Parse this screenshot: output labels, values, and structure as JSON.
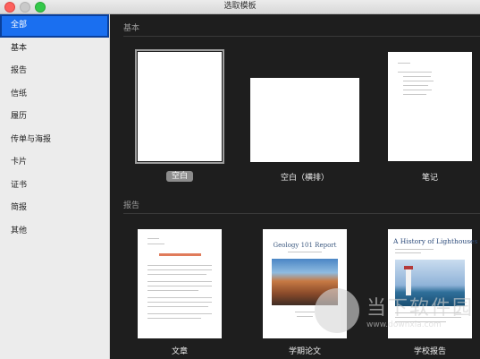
{
  "window": {
    "title": "选取模板"
  },
  "sidebar": {
    "items": [
      {
        "label": "全部",
        "active": true
      },
      {
        "label": "基本",
        "active": false
      },
      {
        "label": "报告",
        "active": false
      },
      {
        "label": "信纸",
        "active": false
      },
      {
        "label": "履历",
        "active": false
      },
      {
        "label": "传单与海报",
        "active": false
      },
      {
        "label": "卡片",
        "active": false
      },
      {
        "label": "证书",
        "active": false
      },
      {
        "label": "简报",
        "active": false
      },
      {
        "label": "其他",
        "active": false
      }
    ]
  },
  "sections": [
    {
      "title": "基本",
      "templates": [
        {
          "label": "空白",
          "selected": true
        },
        {
          "label": "空白（横排）",
          "selected": false
        },
        {
          "label": "笔记",
          "selected": false
        }
      ]
    },
    {
      "title": "报告",
      "templates": [
        {
          "label": "文章",
          "selected": false
        },
        {
          "label": "学期论文",
          "selected": false
        },
        {
          "label": "学校报告",
          "selected": false
        }
      ]
    }
  ],
  "thumbnails": {
    "geology_title": "Geology 101 Report",
    "lighthouses_title": "A History of Lighthouses"
  },
  "watermark": {
    "brand": "当下软件园",
    "url": "www.downxia.com"
  },
  "colors": {
    "accent": "#1a6ff0",
    "background": "#1e1e1e",
    "sidebar": "#ececec"
  }
}
